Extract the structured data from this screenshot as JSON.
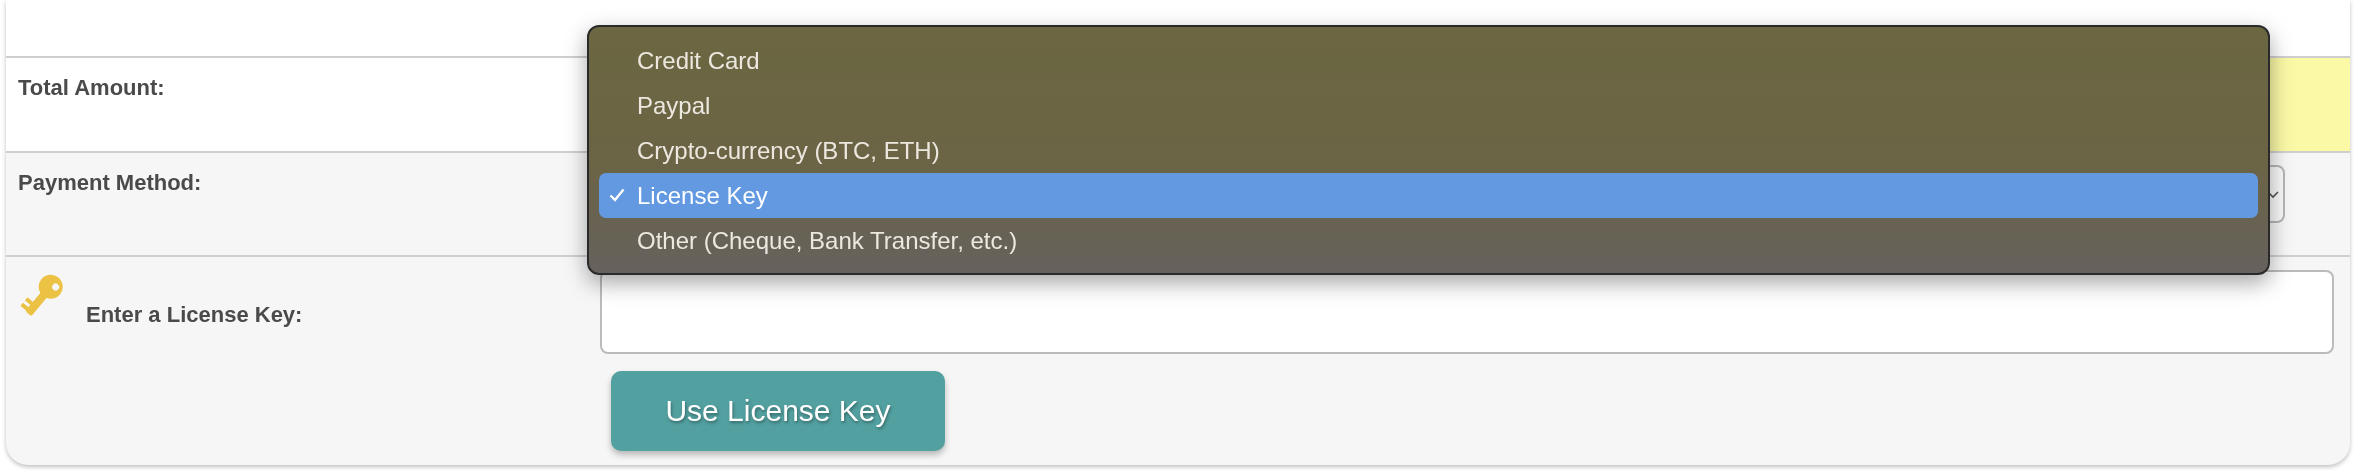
{
  "form": {
    "rows": [
      {
        "kind": "blank"
      },
      {
        "kind": "amount",
        "label": "Total Amount:"
      },
      {
        "kind": "select",
        "label": "Payment Method:",
        "options": [
          {
            "label": "Credit Card",
            "selected": false
          },
          {
            "label": "Paypal",
            "selected": false
          },
          {
            "label": "Crypto-currency (BTC, ETH)",
            "selected": false
          },
          {
            "label": "License Key",
            "selected": true
          },
          {
            "label": "Other (Cheque, Bank Transfer, etc.)",
            "selected": false
          }
        ]
      },
      {
        "kind": "license",
        "label": "Enter a License Key:",
        "button": "Use License Key"
      }
    ]
  }
}
